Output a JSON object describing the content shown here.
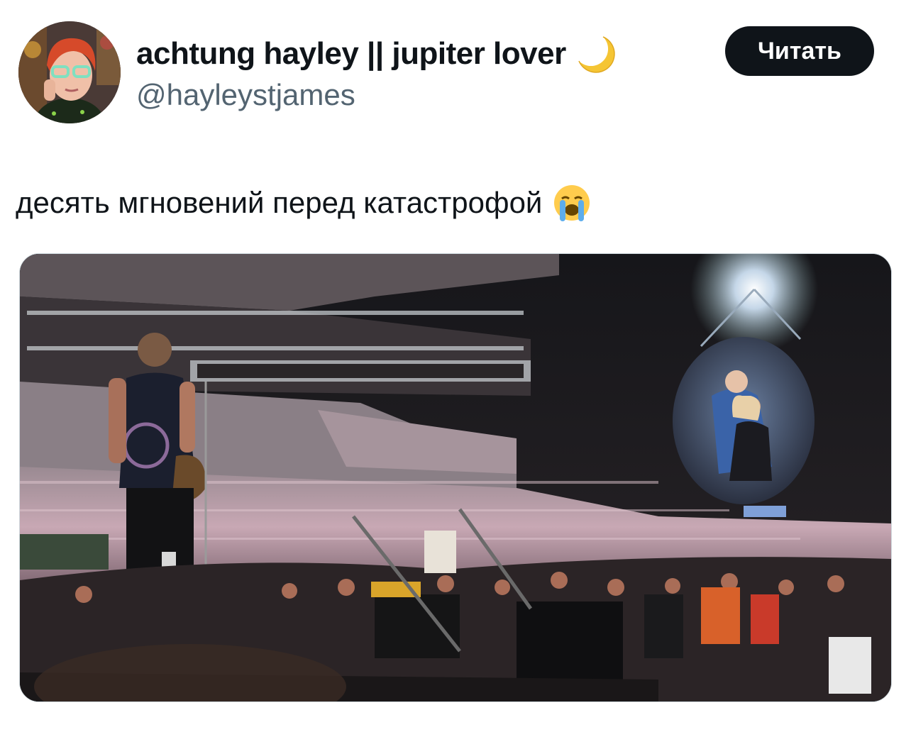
{
  "author": {
    "display_name": "achtung hayley || jupiter lover",
    "handle": "@hayleystjames",
    "name_emoji_icon": "crescent-moon-icon"
  },
  "follow_button": {
    "label": "Читать"
  },
  "tweet": {
    "text": "десять мгновений перед катастрофой",
    "emoji_icon": "loudly-crying-face-icon"
  },
  "media": {
    "type": "photo",
    "colors": {
      "stage_dark": "#121214",
      "crowd_pink": "#c9a3ad",
      "spotlight": "#eaf6ff"
    }
  },
  "colors": {
    "text_primary": "#0f1419",
    "text_secondary": "#536471",
    "button_bg": "#0f1419"
  }
}
